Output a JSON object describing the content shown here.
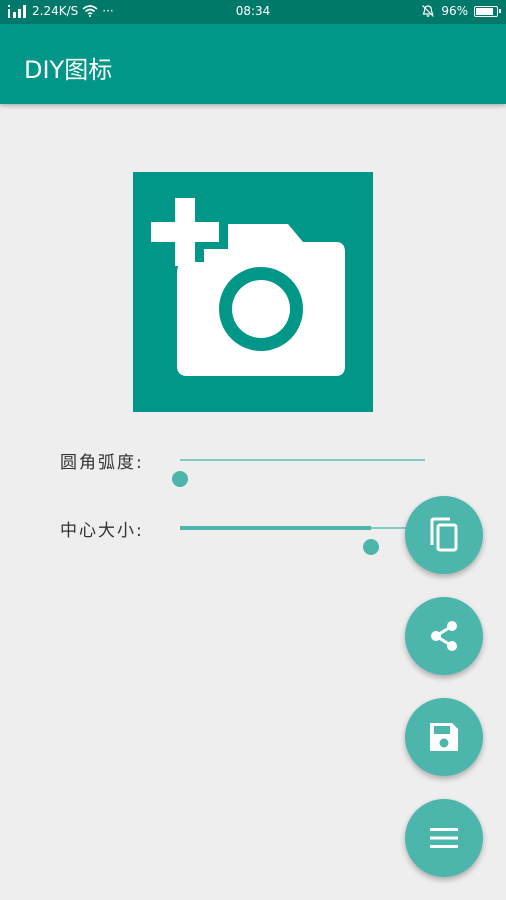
{
  "status_bar": {
    "speed": "2.24K/S",
    "dots": "···",
    "time": "08:34",
    "battery_text": "96%",
    "battery_level": 0.96
  },
  "app_bar": {
    "title": "DIY图标"
  },
  "preview": {
    "icon": "add-a-photo-icon",
    "background": "#009688"
  },
  "sliders": [
    {
      "label": "圆角弧度:",
      "value": 0.0
    },
    {
      "label": "中心大小:",
      "value": 0.78
    }
  ],
  "fabs": [
    {
      "icon": "copy-icon"
    },
    {
      "icon": "share-icon"
    },
    {
      "icon": "save-icon"
    },
    {
      "icon": "menu-icon"
    }
  ],
  "colors": {
    "primary": "#009688",
    "primary_dark": "#00796b",
    "accent": "#4db6ac",
    "background": "#eeeeee"
  }
}
